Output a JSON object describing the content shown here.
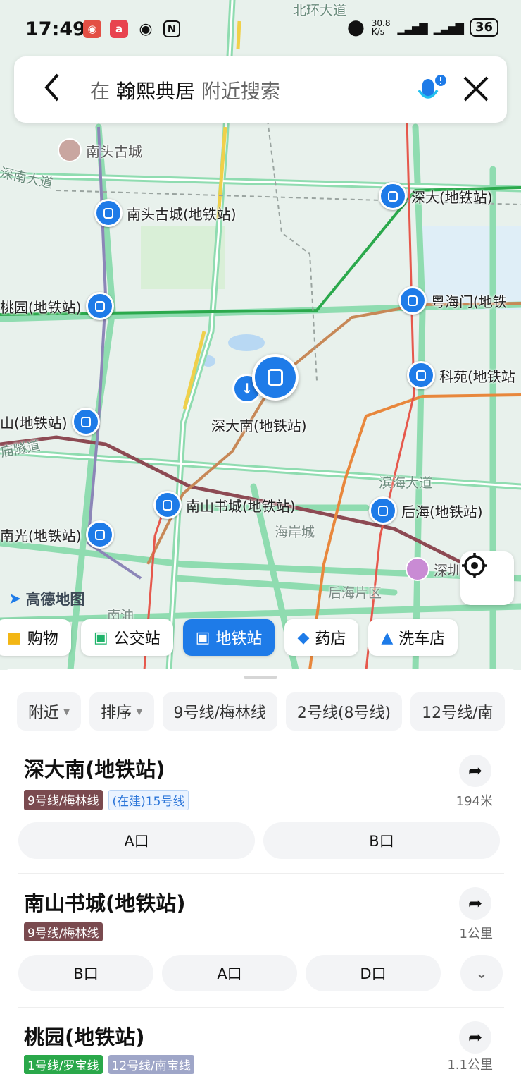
{
  "status_bar": {
    "time": "17:49",
    "speed": "30.8\nK/s",
    "battery": "36"
  },
  "search": {
    "prefix": "在",
    "keyword": "翰熙典居",
    "suffix": "附近搜索"
  },
  "map": {
    "brand": "高德地图",
    "places": {
      "old_town": "南头古城",
      "shenda_nan_pin": "深大南(地铁站)",
      "coastal_city": "海岸城",
      "houhai_area": "后海片区",
      "south_oil": "南油",
      "shenzhen_mall": "深圳"
    },
    "roads": {
      "north_ring": "北环大道",
      "shennan": "深南大道",
      "binhai": "滨海大道",
      "temple_tunnel": "庙隧道"
    },
    "stations": {
      "nantou": "南头古城(地铁站)",
      "shenda": "深大(地铁站)",
      "taoyuan": "桃园(地铁站)",
      "yuehaimen": "粤海门(地铁",
      "keyuan": "科苑(地铁站",
      "shan": "山(地铁站)",
      "nanshan_book": "南山书城(地铁站)",
      "houhai": "后海(地铁站)",
      "nanguang": "南光(地铁站)"
    }
  },
  "categories": [
    {
      "label": "购物",
      "icon": "shopping-bag-icon"
    },
    {
      "label": "公交站",
      "icon": "bus-icon"
    },
    {
      "label": "地铁站",
      "icon": "subway-icon",
      "active": true
    },
    {
      "label": "药店",
      "icon": "pill-icon"
    },
    {
      "label": "洗车店",
      "icon": "car-wash-icon"
    }
  ],
  "filters": [
    {
      "label": "附近",
      "dropdown": true
    },
    {
      "label": "排序",
      "dropdown": true
    },
    {
      "label": "9号线/梅林线"
    },
    {
      "label": "2号线(8号线)"
    },
    {
      "label": "12号线/南"
    }
  ],
  "results": [
    {
      "name": "深大南(地铁站)",
      "tags": [
        "9号线/梅林线",
        "(在建)15号线"
      ],
      "distance": "194米",
      "exits": [
        "A口",
        "B口"
      ]
    },
    {
      "name": "南山书城(地铁站)",
      "tags": [
        "9号线/梅林线"
      ],
      "distance": "1公里",
      "exits": [
        "B口",
        "A口",
        "D口"
      ]
    },
    {
      "name": "桃园(地铁站)",
      "tags": [
        "1号线/罗宝线",
        "12号线/南宝线"
      ],
      "distance": "1.1公里",
      "exits": []
    }
  ],
  "colors": {
    "accent": "#1e7be8",
    "line9": "#7a4a4f",
    "road": "#7fd6a4"
  }
}
